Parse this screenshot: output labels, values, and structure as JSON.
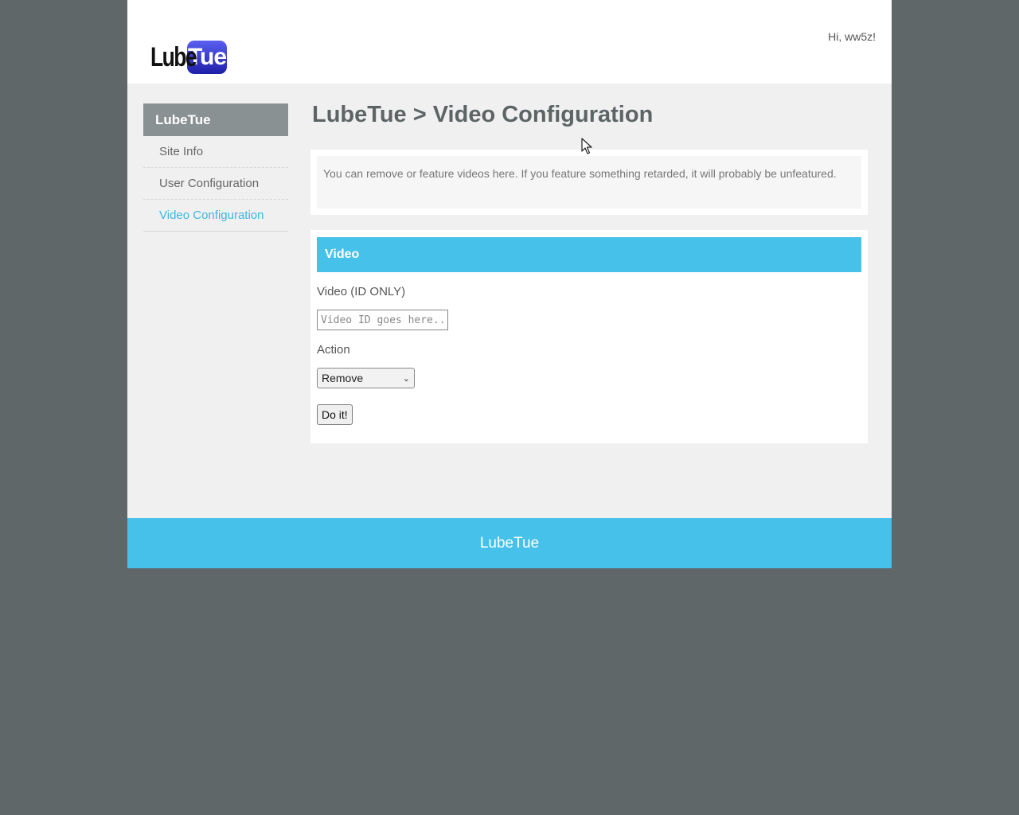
{
  "header": {
    "logo_left": "Lube",
    "logo_right": "Tue",
    "greeting": "Hi, ww5z!"
  },
  "sidebar": {
    "title": "LubeTue",
    "items": [
      {
        "label": "Site Info"
      },
      {
        "label": "User Configuration"
      },
      {
        "label": "Video Configuration",
        "active": true
      }
    ]
  },
  "main": {
    "title": "LubeTue > Video Configuration",
    "info": "You can remove or feature videos here. If you feature something retarded, it will probably be unfeatured.",
    "form": {
      "header": "Video",
      "video_label": "Video (ID ONLY)",
      "video_placeholder": "Video ID goes here...",
      "action_label": "Action",
      "action_selected": "Remove",
      "submit_label": "Do it!"
    }
  },
  "footer": {
    "text": "LubeTue"
  },
  "colors": {
    "accent": "#45c1ea",
    "sidebar_title_bg": "#8a9192",
    "backdrop": "#5f6769"
  },
  "icons": {
    "select_arrow": "chevron-down-icon",
    "cursor": "mouse-pointer-icon"
  }
}
